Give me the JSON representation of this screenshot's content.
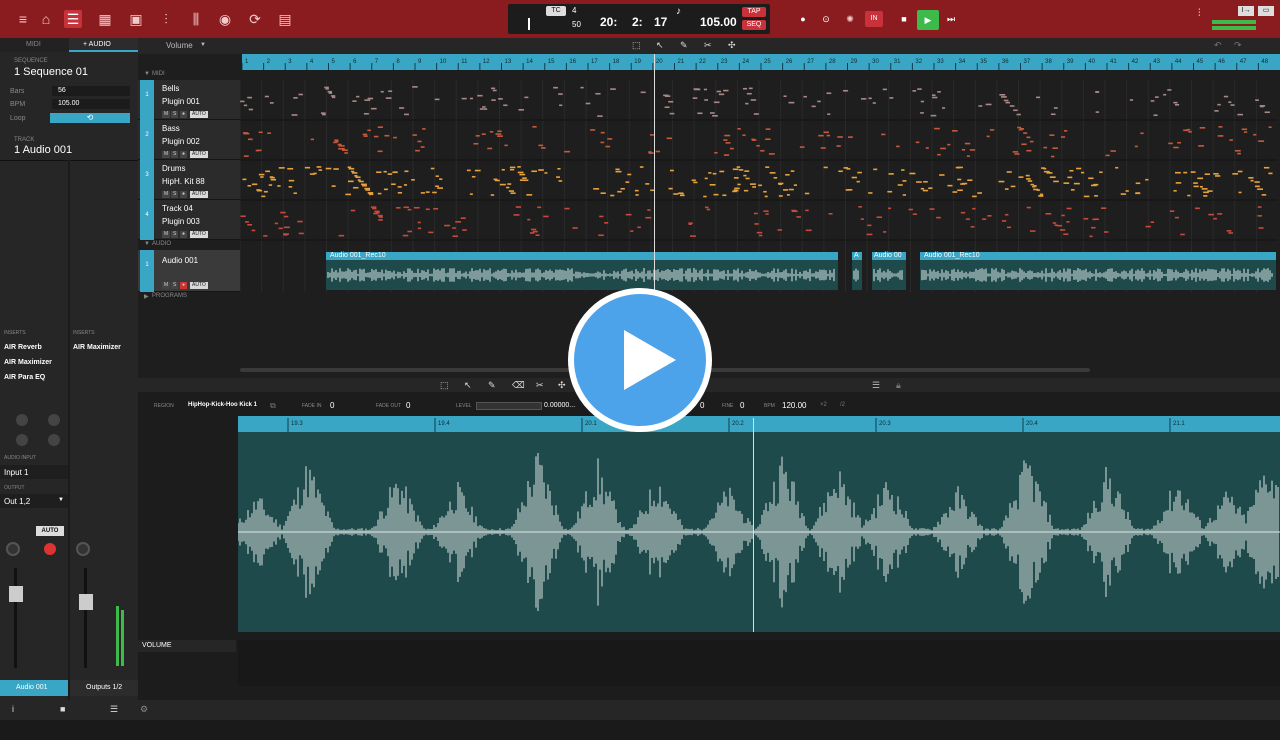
{
  "topbar": {
    "icons": [
      "home-icon",
      "list-icon",
      "grid-icon",
      "plugin-icon",
      "sliders-icon",
      "mixer-icon",
      "record-circle-icon",
      "loop-icon",
      "browser-icon"
    ]
  },
  "transport": {
    "mode_label": "TC",
    "mode_value": "4",
    "swing_value": "50",
    "bar": "20:",
    "beat": "2:",
    "tick": "17",
    "bpm": "105.00",
    "tap_label": "TAP",
    "seq_label": "SEQ",
    "in_label": "IN"
  },
  "left_panel": {
    "tabs": {
      "midi": "MIDI",
      "audio": "+ AUDIO"
    },
    "sequence_label": "SEQUENCE",
    "sequence_name": "1 Sequence 01",
    "bars_label": "Bars",
    "bars_value": "56",
    "bpm_label": "BPM",
    "bpm_value": "105.00",
    "loop_label": "Loop",
    "track_label": "TRACK",
    "track_name": "1 Audio 001",
    "inserts_label": "INSERTS",
    "inserts_left": [
      "AIR Reverb",
      "AIR Maximizer",
      "AIR Para EQ"
    ],
    "inserts_right": [
      "AIR Maximizer"
    ],
    "audio_input_label": "AUDIO INPUT",
    "audio_input_value": "Input 1",
    "output_label": "OUTPUT",
    "output_value": "Out 1,2",
    "auto_label": "AUTO",
    "footer_left": "Audio 001",
    "footer_right": "Outputs 1/2"
  },
  "arranger": {
    "view_label": "Volume",
    "midi_section": "MIDI",
    "audio_section": "AUDIO",
    "programs_section": "PROGRAMS",
    "midi_tracks": [
      {
        "num": "1",
        "name": "Bells",
        "plugin": "Plugin 001"
      },
      {
        "num": "2",
        "name": "Bass",
        "plugin": "Plugin 002"
      },
      {
        "num": "3",
        "name": "Drums",
        "plugin": "HipH. Kit 88"
      },
      {
        "num": "4",
        "name": "Track 04",
        "plugin": "Plugin 003"
      }
    ],
    "audio_track": {
      "num": "1",
      "name": "Audio 001"
    },
    "audio_regions": [
      "Audio 001_Rec10",
      "A",
      "Audio 00",
      "Audio 001_Rec10"
    ],
    "ruler": [
      "1",
      "2",
      "3",
      "4",
      "5",
      "6",
      "7",
      "8",
      "9",
      "10",
      "11",
      "12",
      "13",
      "14",
      "15",
      "16",
      "17",
      "18",
      "19",
      "20",
      "21",
      "22",
      "23",
      "24",
      "25",
      "26",
      "27",
      "28",
      "29",
      "30",
      "31",
      "32",
      "33",
      "34",
      "35",
      "36",
      "37",
      "38",
      "39",
      "40",
      "41",
      "42",
      "43",
      "44",
      "45",
      "46",
      "47",
      "48"
    ]
  },
  "sample_editor": {
    "region_label": "REGION",
    "region_value": "HipHop-Kick-Hoo Kick 1",
    "fade_in_label": "FADE IN",
    "fade_in_value": "0",
    "fade_out_label": "FADE OUT",
    "fade_out_value": "0",
    "level_label": "LEVEL",
    "level_value": "0.00000...",
    "coarse_value": "0",
    "fine_label": "FINE",
    "fine_value": "0",
    "bpm_label": "BPM",
    "bpm_value": "120.00",
    "ruler": [
      "19.3",
      "19.4",
      "20.1",
      "20.2",
      "20.3",
      "20.4",
      "21.1"
    ],
    "volume_label": "VOLUME"
  },
  "colors": {
    "topbar": "#8a1c20",
    "accent": "#3aa6c5",
    "waveform_bg": "#1f4a4b",
    "play": "#4da3ea"
  }
}
